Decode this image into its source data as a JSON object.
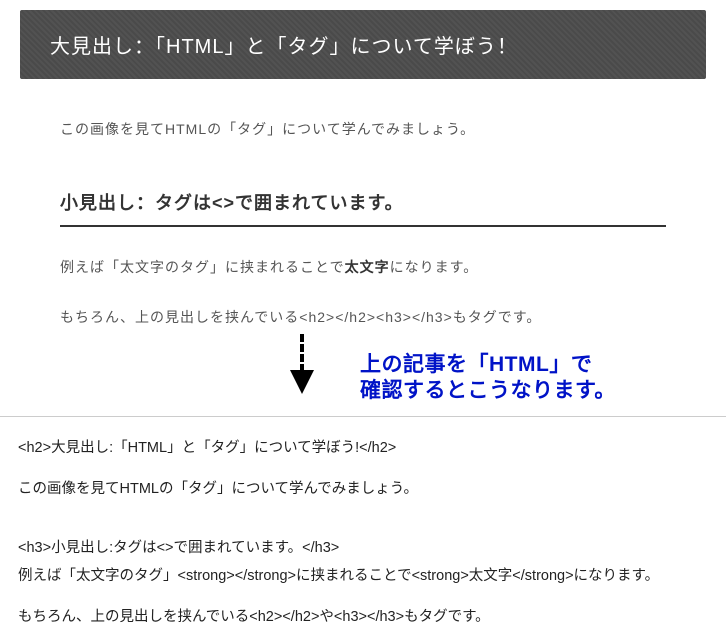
{
  "heading": "大見出し：「HTML」と「タグ」について学ぼう！",
  "intro": "この画像を見てHTMLの「タグ」について学んでみましょう。",
  "subheading": "小見出し：タグは<>で囲まれています。",
  "para1_a": "例えば「太文字のタグ」に挟まれることで",
  "para1_bold": "太文字",
  "para1_b": "になります。",
  "para2": "もちろん、上の見出しを挟んでいる<h2></h2><h3></h3>もタグです。",
  "annotation_line1": "上の記事を「HTML」で",
  "annotation_line2": "確認するとこうなります。",
  "code": {
    "l1": "<h2>大見出し:「HTML」と「タグ」について学ぼう!</h2>",
    "l2": "この画像を見てHTMLの「タグ」について学んでみましょう。",
    "l3": "<h3>小見出し:タグは<>で囲まれています。</h3>",
    "l4": "例えば「太文字のタグ」<strong></strong>に挟まれることで<strong>太文字</strong>になります。",
    "l5": "もちろん、上の見出しを挟んでいる<h2></h2>や<h3></h3>もタグです。"
  }
}
